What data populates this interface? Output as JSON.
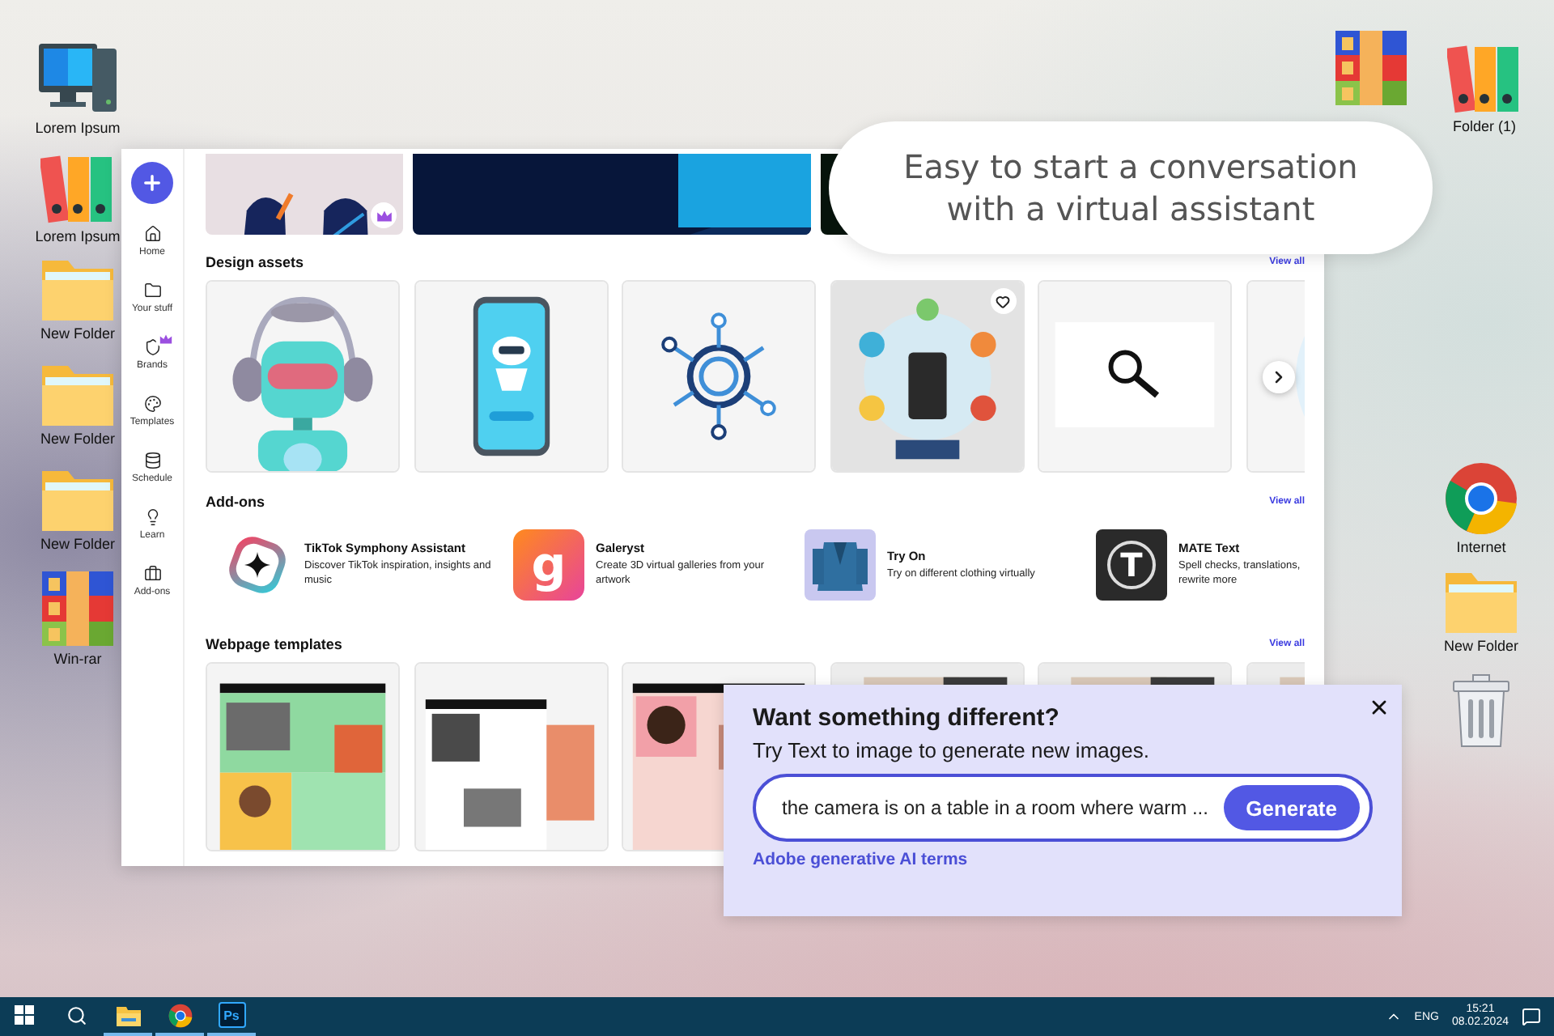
{
  "desktop_left": [
    {
      "label": "Lorem Ipsum",
      "kind": "computer"
    },
    {
      "label": "Lorem Ipsum",
      "kind": "binders"
    },
    {
      "label": "New Folder",
      "kind": "folder"
    },
    {
      "label": "New Folder",
      "kind": "folder"
    },
    {
      "label": "New Folder",
      "kind": "folder"
    },
    {
      "label": "Win-rar",
      "kind": "archive"
    }
  ],
  "desktop_right": [
    {
      "kind": "archive"
    },
    {
      "label": "Folder (1)",
      "kind": "binders"
    },
    {
      "label": "Internet",
      "kind": "browser"
    },
    {
      "label": "New Folder",
      "kind": "folder"
    },
    {
      "kind": "trash"
    }
  ],
  "app": {
    "sidebar": [
      {
        "label": "Home",
        "kind": "home"
      },
      {
        "label": "Your stuff",
        "kind": "stuff"
      },
      {
        "label": "Brands",
        "kind": "brands",
        "premium": true
      },
      {
        "label": "Templates",
        "kind": "templates"
      },
      {
        "label": "Schedule",
        "kind": "schedule"
      },
      {
        "label": "Learn",
        "kind": "learn"
      },
      {
        "label": "Add-ons",
        "kind": "addons"
      }
    ],
    "top_row": [
      {
        "kind": "picture",
        "premium": true
      },
      {
        "kind": "picture"
      },
      {
        "kind": "picture"
      }
    ],
    "sections": [
      {
        "kind": "gallery",
        "title": "Design assets",
        "link": "View all",
        "cards": [
          {
            "kind": "picture"
          },
          {
            "kind": "picture"
          },
          {
            "kind": "picture"
          },
          {
            "kind": "picture",
            "favorite_button": true
          },
          {
            "kind": "picture"
          },
          {
            "kind": "picture",
            "next_button": true
          }
        ]
      },
      {
        "kind": "addons",
        "title": "Add-ons",
        "link": "View all",
        "items": [
          {
            "kind": "symphony",
            "title": "TikTok Symphony Assistant",
            "description": "Discover TikTok inspiration, insights and music"
          },
          {
            "kind": "letter",
            "logo_text": "g",
            "title": "Galeryst",
            "description": "Create 3D virtual galleries from your artwork"
          },
          {
            "kind": "picture",
            "title": "Try On",
            "description": "Try on different clothing virtually"
          },
          {
            "kind": "mate",
            "logo_text": "T",
            "title": "MATE Text",
            "description": "Spell checks, translations, rewrite more"
          }
        ]
      },
      {
        "kind": "gallery",
        "title": "Webpage templates",
        "link": "View all",
        "cards": [
          {
            "kind": "picture"
          },
          {
            "kind": "picture"
          },
          {
            "kind": "picture"
          },
          {
            "kind": "picture"
          },
          {
            "kind": "picture"
          },
          {
            "kind": "picture"
          }
        ]
      }
    ]
  },
  "bubble": {
    "text": "Easy to start a conversation with a virtual assistant"
  },
  "popup": {
    "title": "Want something different?",
    "subtitle": "Try Text to image to generate new images.",
    "prompt": "the camera is on a table in a room where warm ...",
    "button": "Generate",
    "link": "Adobe generative AI terms"
  },
  "taskbar": {
    "apps": [
      {
        "kind": "explorer",
        "open": true
      },
      {
        "kind": "browser",
        "open": true
      },
      {
        "kind": "photoshop",
        "label": "Ps",
        "open": true
      }
    ],
    "language": "ENG",
    "time": "15:21",
    "date": "08.02.2024"
  }
}
